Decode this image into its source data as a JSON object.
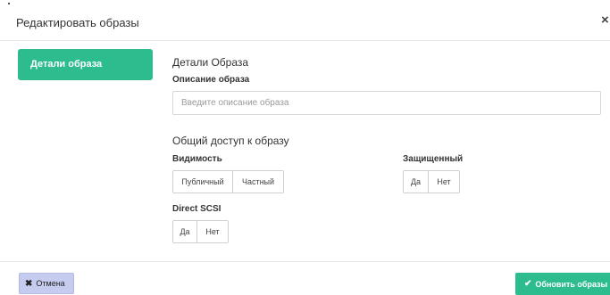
{
  "modal": {
    "title": "Редактировать образы",
    "close_icon": "×"
  },
  "sidebar": {
    "tabs": [
      {
        "label": "Детали образа"
      }
    ]
  },
  "details": {
    "heading": "Детали Образа",
    "description": {
      "label": "Описание образа",
      "placeholder": "Введите описание образа",
      "value": ""
    }
  },
  "sharing": {
    "heading": "Общий доступ к образу",
    "visibility": {
      "label": "Видимость",
      "options": [
        "Публичный",
        "Частный"
      ]
    },
    "protected": {
      "label": "Защищенный",
      "options": [
        "Да",
        "Нет"
      ]
    },
    "direct_scsi": {
      "label": "Direct SCSI",
      "options": [
        "Да",
        "Нет"
      ]
    }
  },
  "footer": {
    "cancel_label": "Отмена",
    "cancel_icon": "✖",
    "submit_label": "Обновить образы",
    "submit_icon": "✔"
  },
  "colors": {
    "accent": "#2cbc8e",
    "cancel_bg": "#c6cbf0"
  }
}
